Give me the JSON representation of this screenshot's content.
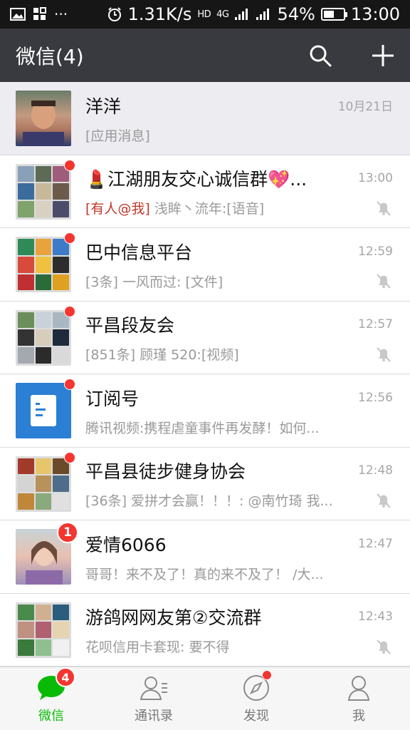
{
  "status_bar": {
    "net_speed": "1.31K/s",
    "hd": "HD",
    "signal1": "4G",
    "battery": "54%",
    "battery_level": 0.54,
    "time": "13:00"
  },
  "header": {
    "title": "微信(4)",
    "search_icon": "search-icon",
    "add_icon": "plus-icon"
  },
  "chats": [
    {
      "name": "洋洋",
      "time": "10月21日",
      "preview": "[应用消息]",
      "mention": "",
      "pinned": true,
      "unread_dot": false,
      "unread_count": "",
      "muted": false
    },
    {
      "name": "💄江湖朋友交心诚信群💖...",
      "time": "13:00",
      "preview": "浅眸丶流年:[语音]",
      "mention": "[有人@我]",
      "pinned": false,
      "unread_dot": true,
      "unread_count": "",
      "muted": true
    },
    {
      "name": "巴中信息平台",
      "time": "12:59",
      "preview": "[3条] 一风而过: [文件]",
      "mention": "",
      "pinned": false,
      "unread_dot": true,
      "unread_count": "",
      "muted": true
    },
    {
      "name": "平昌段友会",
      "time": "12:57",
      "preview": "[851条] 顾瑾 520:[视频]",
      "mention": "",
      "pinned": false,
      "unread_dot": true,
      "unread_count": "",
      "muted": true
    },
    {
      "name": "订阅号",
      "time": "12:56",
      "preview": "腾讯视频:携程虐童事件再发酵！如何...",
      "mention": "",
      "pinned": false,
      "unread_dot": true,
      "unread_count": "",
      "muted": false
    },
    {
      "name": "平昌县徒步健身协会",
      "time": "12:48",
      "preview": "[36条] 爱拼才会赢！！！: @南竹琦 我...",
      "mention": "",
      "pinned": false,
      "unread_dot": true,
      "unread_count": "",
      "muted": true
    },
    {
      "name": "爱情6066",
      "time": "12:47",
      "preview": "哥哥！来不及了！真的来不及了！ /大...",
      "mention": "",
      "pinned": false,
      "unread_dot": false,
      "unread_count": "1",
      "muted": false
    },
    {
      "name": "游鸽网网友第②交流群",
      "time": "12:43",
      "preview": "花呗信用卡套现: 要不得",
      "mention": "",
      "pinned": false,
      "unread_dot": false,
      "unread_count": "",
      "muted": true
    }
  ],
  "tabs": [
    {
      "label": "微信",
      "icon": "chat-bubble-icon",
      "badge": "4",
      "active": true
    },
    {
      "label": "通讯录",
      "icon": "contacts-icon",
      "badge": "",
      "active": false
    },
    {
      "label": "发现",
      "icon": "compass-icon",
      "badge": "",
      "active": false
    },
    {
      "label": "我",
      "icon": "person-icon",
      "badge": "",
      "active": false
    }
  ],
  "colors": {
    "header_bg": "#393a3f",
    "status_bg": "#161616",
    "accent_green": "#09bb07",
    "badge_red": "#f43530"
  }
}
